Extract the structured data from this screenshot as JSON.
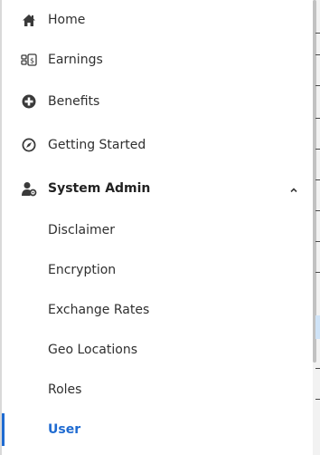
{
  "nav": {
    "items": [
      {
        "label": "Home",
        "icon": "home-icon"
      },
      {
        "label": "Earnings",
        "icon": "earnings-icon"
      },
      {
        "label": "Benefits",
        "icon": "benefits-icon"
      },
      {
        "label": "Getting Started",
        "icon": "getting-started-icon"
      },
      {
        "label": "System Admin",
        "icon": "system-admin-icon",
        "expanded": true
      }
    ],
    "sub_items": [
      {
        "label": "Disclaimer"
      },
      {
        "label": "Encryption"
      },
      {
        "label": "Exchange Rates"
      },
      {
        "label": "Geo Locations"
      },
      {
        "label": "Roles"
      },
      {
        "label": "User",
        "active": true
      }
    ]
  },
  "colors": {
    "active": "#1f6bd1",
    "text": "#2f2f2f",
    "icon": "#3a3a3a"
  }
}
